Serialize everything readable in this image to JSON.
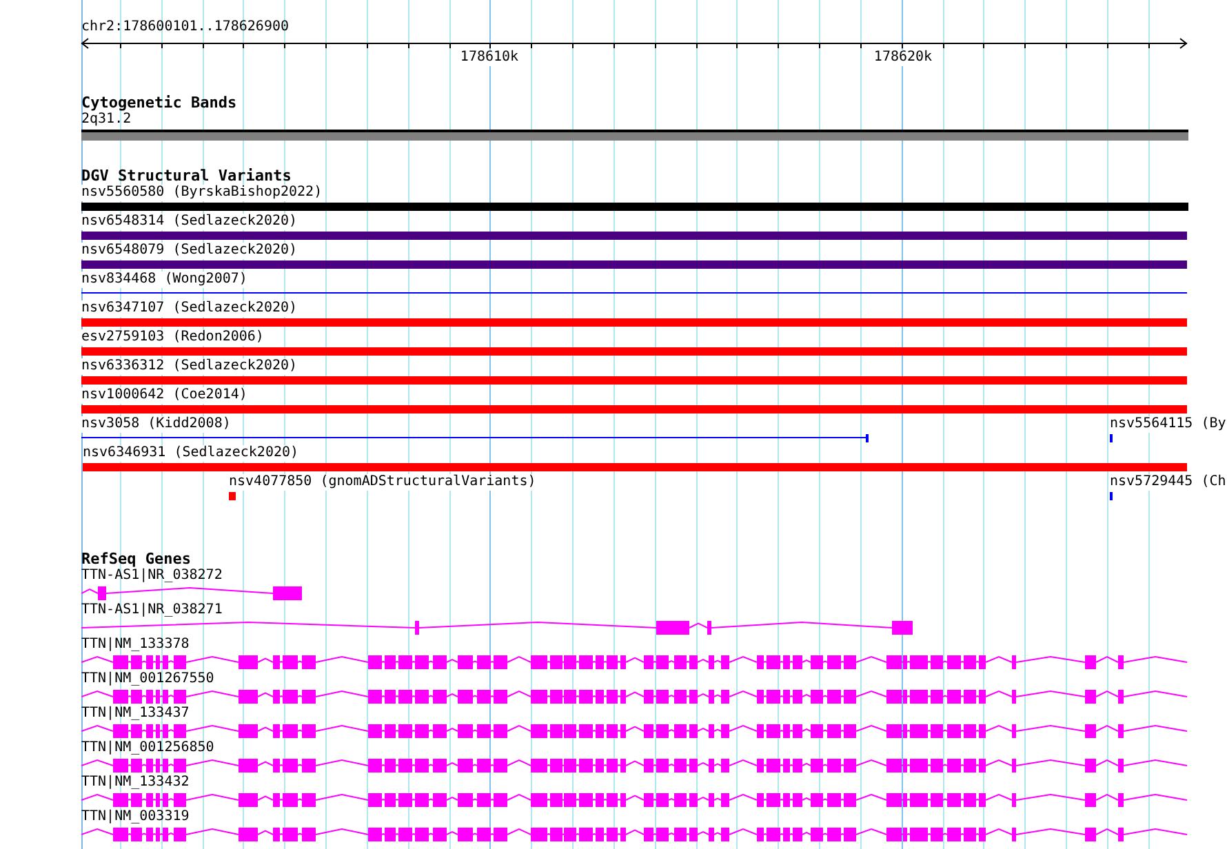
{
  "ruler": {
    "location": "chr2:178600101..178626900",
    "ticks": [
      "178610k",
      "178620k"
    ]
  },
  "cytoband": {
    "title": "Cytogenetic Bands",
    "band": "2q31.2"
  },
  "dgv": {
    "title": "DGV Structural Variants",
    "lanes": [
      [
        {
          "label": "nsv5560580 (ByrskaBishop2022)",
          "color": "#000000",
          "kind": "bar"
        }
      ],
      [
        {
          "label": "nsv6548314 (Sedlazeck2020)",
          "color": "#4b0082",
          "kind": "bar"
        }
      ],
      [
        {
          "label": "nsv6548079 (Sedlazeck2020)",
          "color": "#4b0082",
          "kind": "bar"
        }
      ],
      [
        {
          "label": "nsv834468 (Wong2007)",
          "color": "#0000ff",
          "kind": "line"
        }
      ],
      [
        {
          "label": "nsv6347107 (Sedlazeck2020)",
          "color": "#ff0000",
          "kind": "bar"
        }
      ],
      [
        {
          "label": "esv2759103 (Redon2006)",
          "color": "#ff0000",
          "kind": "bar"
        }
      ],
      [
        {
          "label": "nsv6336312 (Sedlazeck2020)",
          "color": "#ff0000",
          "kind": "bar"
        }
      ],
      [
        {
          "label": "nsv1000642 (Coe2014)",
          "color": "#ff0000",
          "kind": "bar"
        }
      ],
      [
        {
          "label": "nsv3058 (Kidd2008)",
          "color": "#0000ff",
          "kind": "line"
        },
        {
          "label": "nsv5564115 (By",
          "color": "#0000ff",
          "kind": "bar"
        }
      ],
      [
        {
          "label": "nsv6346931 (Sedlazeck2020)",
          "color": "#ff0000",
          "kind": "bar"
        }
      ],
      [
        {
          "label": "nsv4077850 (gnomADStructuralVariants)",
          "color": "#ff0000",
          "kind": "bar"
        },
        {
          "label": "nsv5729445 (Ch",
          "color": "#0000ff",
          "kind": "bar"
        }
      ]
    ]
  },
  "refseq": {
    "title": "RefSeq Genes",
    "transcripts": [
      {
        "label": "TTN-AS1|NR_038272"
      },
      {
        "label": "TTN-AS1|NR_038271"
      },
      {
        "label": "TTN|NM_133378"
      },
      {
        "label": "TTN|NM_001267550"
      },
      {
        "label": "TTN|NM_133437"
      },
      {
        "label": "TTN|NM_001256850"
      },
      {
        "label": "TTN|NM_133432"
      },
      {
        "label": "TTN|NM_003319"
      }
    ]
  }
}
